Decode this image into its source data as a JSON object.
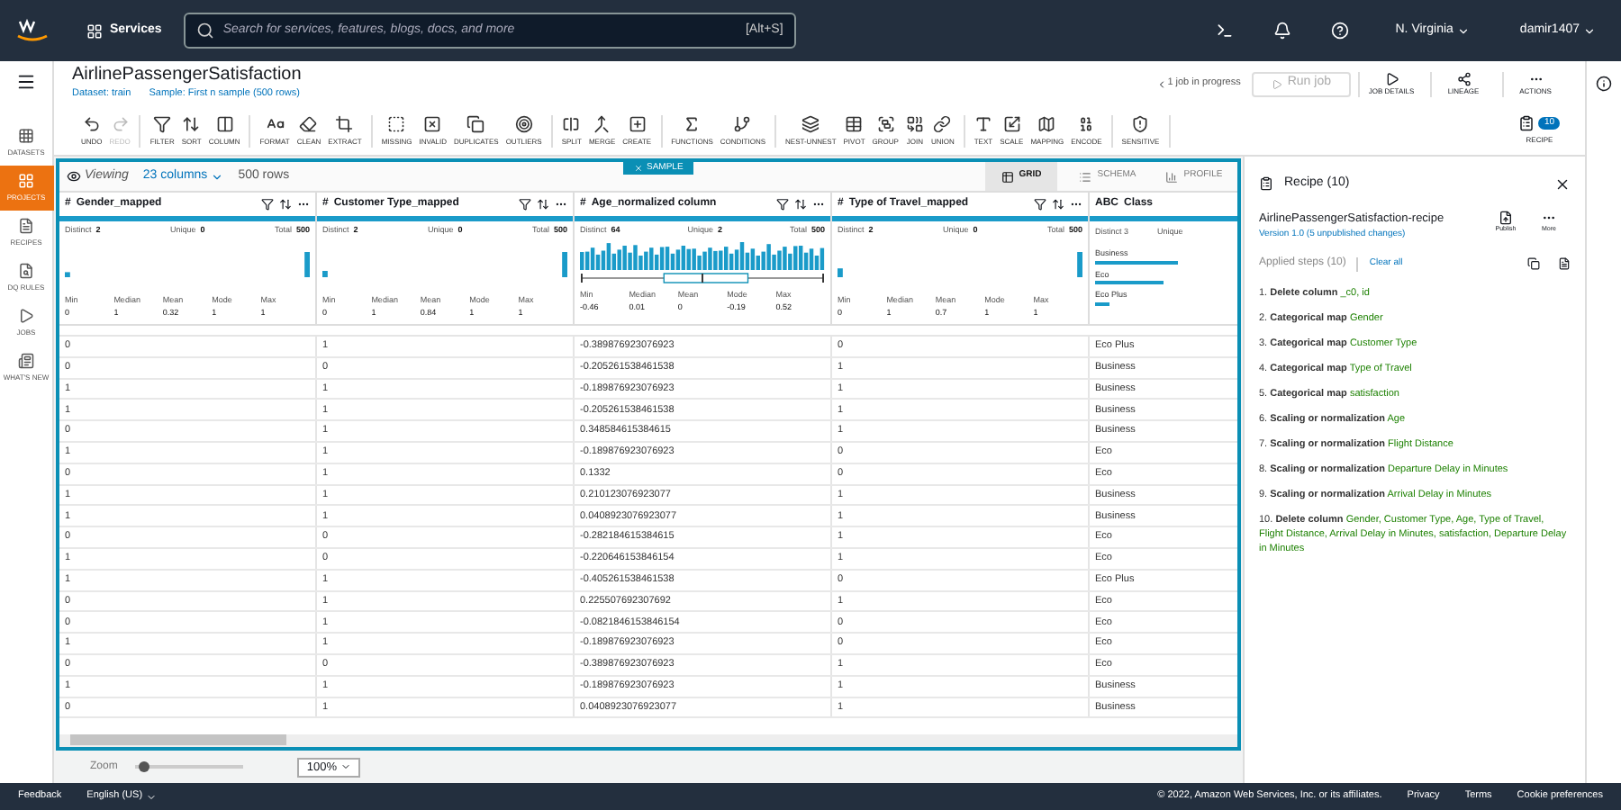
{
  "nav": {
    "services": "Services",
    "search_placeholder": "Search for services, features, blogs, docs, and more",
    "shortcut": "[Alt+S]",
    "region": "N. Virginia",
    "user": "damir1407"
  },
  "sidebar": {
    "items": [
      {
        "label": "DATASETS",
        "selected": false
      },
      {
        "label": "PROJECTS",
        "selected": true
      },
      {
        "label": "RECIPES",
        "selected": false
      },
      {
        "label": "DQ RULES",
        "selected": false
      },
      {
        "label": "JOBS",
        "selected": false
      },
      {
        "label": "WHAT'S NEW",
        "selected": false
      }
    ]
  },
  "header": {
    "title": "AirlinePassengerSatisfaction",
    "dataset": "Dataset: train",
    "sample": "Sample: First n sample (500 rows)",
    "jobs": "1 job in progress",
    "run_job": {
      "label": "Run job",
      "disabled": true
    },
    "actions": [
      "JOB DETAILS",
      "LINEAGE",
      "ACTIONS"
    ]
  },
  "toolbar": {
    "groups": [
      [
        {
          "label": "UNDO",
          "disabled": false
        },
        {
          "label": "REDO",
          "disabled": true
        }
      ],
      [
        {
          "label": "FILTER",
          "disabled": false
        },
        {
          "label": "SORT",
          "disabled": false
        },
        {
          "label": "COLUMN",
          "disabled": false
        }
      ],
      [
        {
          "label": "FORMAT",
          "disabled": false
        },
        {
          "label": "CLEAN",
          "disabled": false
        },
        {
          "label": "EXTRACT",
          "disabled": false
        }
      ],
      [
        {
          "label": "MISSING",
          "disabled": false
        },
        {
          "label": "INVALID",
          "disabled": false
        },
        {
          "label": "DUPLICATES",
          "disabled": false
        },
        {
          "label": "OUTLIERS",
          "disabled": false
        }
      ],
      [
        {
          "label": "SPLIT",
          "disabled": false
        },
        {
          "label": "MERGE",
          "disabled": false
        },
        {
          "label": "CREATE",
          "disabled": false
        }
      ],
      [
        {
          "label": "FUNCTIONS",
          "disabled": false
        },
        {
          "label": "CONDITIONS",
          "disabled": false
        }
      ],
      [
        {
          "label": "NEST-UNNEST",
          "disabled": false
        },
        {
          "label": "PIVOT",
          "disabled": false
        },
        {
          "label": "GROUP",
          "disabled": false
        },
        {
          "label": "JOIN",
          "disabled": false
        },
        {
          "label": "UNION",
          "disabled": false
        }
      ],
      [
        {
          "label": "TEXT",
          "disabled": false
        },
        {
          "label": "SCALE",
          "disabled": false
        },
        {
          "label": "MAPPING",
          "disabled": false
        },
        {
          "label": "ENCODE",
          "disabled": false
        }
      ],
      [
        {
          "label": "SENSITIVE",
          "disabled": false
        }
      ]
    ],
    "recipe": {
      "label": "RECIPE",
      "badge": "10"
    }
  },
  "grid": {
    "viewing": "Viewing",
    "columns_count": "23 columns",
    "rows_count": "500 rows",
    "sample_tag": "SAMPLE",
    "views": [
      {
        "label": "GRID",
        "selected": true
      },
      {
        "label": "SCHEMA",
        "selected": false
      },
      {
        "label": "PROFILE",
        "selected": false
      }
    ],
    "columns": [
      {
        "kind": "binary",
        "type": "#",
        "name": "Gender_mapped",
        "stats": [
          [
            "Distinct",
            "2"
          ],
          [
            "Unique",
            "0"
          ],
          [
            "Total",
            "500"
          ]
        ],
        "summary": [
          [
            "Min",
            "0"
          ],
          [
            "Median",
            "1"
          ],
          [
            "Mean",
            "0.32"
          ],
          [
            "Mode",
            "1"
          ],
          [
            "Max",
            "1"
          ]
        ]
      },
      {
        "kind": "binary",
        "type": "#",
        "name": "Customer Type_mapped",
        "stats": [
          [
            "Distinct",
            "2"
          ],
          [
            "Unique",
            "0"
          ],
          [
            "Total",
            "500"
          ]
        ],
        "summary": [
          [
            "Min",
            "0"
          ],
          [
            "Median",
            "1"
          ],
          [
            "Mean",
            "0.84"
          ],
          [
            "Mode",
            "1"
          ],
          [
            "Max",
            "1"
          ]
        ]
      },
      {
        "kind": "continuous",
        "type": "#",
        "name": "Age_normalized column",
        "stats": [
          [
            "Distinct",
            "64"
          ],
          [
            "Unique",
            "2"
          ],
          [
            "Total",
            "500"
          ]
        ],
        "summary": [
          [
            "Min",
            "-0.46"
          ],
          [
            "Median",
            "0.01"
          ],
          [
            "Mean",
            "0"
          ],
          [
            "Mode",
            "-0.19"
          ],
          [
            "Max",
            "0.52"
          ]
        ]
      },
      {
        "kind": "binary",
        "type": "#",
        "name": "Type of Travel_mapped",
        "stats": [
          [
            "Distinct",
            "2"
          ],
          [
            "Unique",
            "0"
          ],
          [
            "Total",
            "500"
          ]
        ],
        "summary": [
          [
            "Min",
            "0"
          ],
          [
            "Median",
            "1"
          ],
          [
            "Mean",
            "0.7"
          ],
          [
            "Mode",
            "1"
          ],
          [
            "Max",
            "1"
          ]
        ]
      },
      {
        "kind": "categorical",
        "type": "ABC",
        "name": "Class",
        "stats": [
          [
            "Distinct",
            "3"
          ],
          [
            "Unique"
          ]
        ],
        "categories": [
          {
            "label": "Business",
            "level": 0.6
          },
          {
            "label": "Eco",
            "level": 0.5
          },
          {
            "label": "Eco Plus",
            "level": 0.1
          }
        ]
      }
    ],
    "rows": [
      [
        "0",
        "1",
        "-0.389876923076923",
        "0",
        "Eco Plus"
      ],
      [
        "0",
        "0",
        "-0.205261538461538",
        "1",
        "Business"
      ],
      [
        "1",
        "1",
        "-0.189876923076923",
        "1",
        "Business"
      ],
      [
        "1",
        "1",
        "-0.205261538461538",
        "1",
        "Business"
      ],
      [
        "0",
        "1",
        "0.348584615384615",
        "1",
        "Business"
      ],
      [
        "1",
        "1",
        "-0.189876923076923",
        "0",
        "Eco"
      ],
      [
        "0",
        "1",
        "0.1332",
        "0",
        "Eco"
      ],
      [
        "1",
        "1",
        "0.210123076923077",
        "1",
        "Business"
      ],
      [
        "1",
        "1",
        "0.0408923076923077",
        "1",
        "Business"
      ],
      [
        "0",
        "0",
        "-0.282184615384615",
        "1",
        "Eco"
      ],
      [
        "1",
        "0",
        "-0.220646153846154",
        "1",
        "Eco"
      ],
      [
        "1",
        "1",
        "-0.405261538461538",
        "0",
        "Eco Plus"
      ],
      [
        "0",
        "1",
        "0.225507692307692",
        "1",
        "Eco"
      ],
      [
        "0",
        "1",
        "-0.0821846153846154",
        "0",
        "Eco"
      ],
      [
        "1",
        "1",
        "-0.189876923076923",
        "0",
        "Eco"
      ],
      [
        "0",
        "0",
        "-0.389876923076923",
        "1",
        "Eco"
      ],
      [
        "1",
        "1",
        "-0.189876923076923",
        "1",
        "Business"
      ],
      [
        "0",
        "1",
        "0.0408923076923077",
        "1",
        "Business"
      ]
    ]
  },
  "recipe": {
    "title": "Recipe (10)",
    "name": "AirlinePassengerSatisfaction-recipe",
    "version": "Version 1.0 (5 unpublished changes)",
    "publish": "Publish",
    "more": "More",
    "applied": "Applied steps (10)",
    "clear": "Clear all",
    "steps": [
      {
        "num": "1.",
        "action": "Delete column",
        "target": "_c0, id"
      },
      {
        "num": "2.",
        "action": "Categorical map",
        "target": "Gender"
      },
      {
        "num": "3.",
        "action": "Categorical map",
        "target": "Customer Type"
      },
      {
        "num": "4.",
        "action": "Categorical map",
        "target": "Type of Travel"
      },
      {
        "num": "5.",
        "action": "Categorical map",
        "target": "satisfaction"
      },
      {
        "num": "6.",
        "action": "Scaling or normalization",
        "target": "Age"
      },
      {
        "num": "7.",
        "action": "Scaling or normalization",
        "target": "Flight Distance"
      },
      {
        "num": "8.",
        "action": "Scaling or normalization",
        "target": "Departure Delay in Minutes"
      },
      {
        "num": "9.",
        "action": "Scaling or normalization",
        "target": "Arrival Delay in Minutes"
      },
      {
        "num": "10.",
        "action": "Delete column",
        "target": "Gender, Customer Type, Age, Type of Travel, Flight Distance, Arrival Delay in Minutes, satisfaction, Departure Delay in Minutes"
      }
    ]
  },
  "zoom": {
    "label": "Zoom",
    "level": 0.02,
    "value": "100%"
  },
  "footer": {
    "feedback": "Feedback",
    "language": "English (US)",
    "copyright": "© 2022, Amazon Web Services, Inc. or its affiliates.",
    "links": [
      "Privacy",
      "Terms",
      "Cookie preferences"
    ]
  }
}
